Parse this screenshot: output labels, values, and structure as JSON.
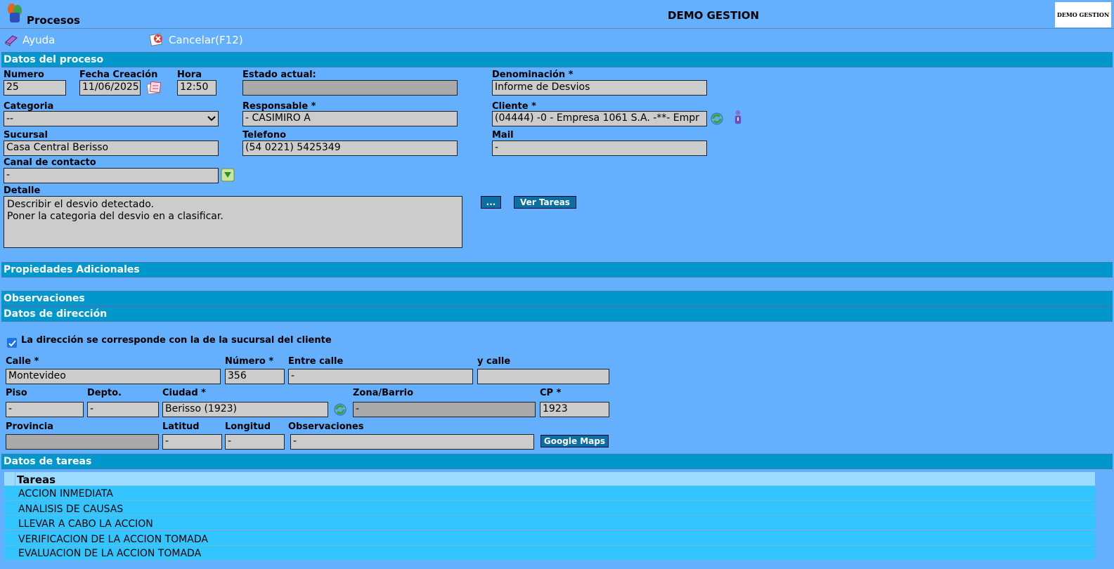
{
  "header": {
    "app_title": "Procesos",
    "center_title": "DEMO GESTION",
    "logo_text": "DEMO GESTION"
  },
  "toolbar": {
    "help_label": "Ayuda",
    "cancel_label": "Cancelar(F12)"
  },
  "sections": {
    "proceso": "Datos del proceso",
    "propiedades": "Propiedades Adicionales",
    "observaciones": "Observaciones",
    "direccion": "Datos de dirección",
    "tareas": "Datos de tareas"
  },
  "proceso": {
    "numero_label": "Numero",
    "numero": "25",
    "fecha_label": "Fecha Creación",
    "fecha": "11/06/2025",
    "hora_label": "Hora",
    "hora": "12:50",
    "estado_label": "Estado actual:",
    "estado": "",
    "denominacion_label": "Denominación *",
    "denominacion": "Informe de Desvios",
    "categoria_label": "Categoria",
    "categoria": "--",
    "responsable_label": "Responsable *",
    "responsable": "- CASIMIRO A",
    "cliente_label": "Cliente *",
    "cliente": "(04444) -0 - Empresa 1061 S.A. -**- Empr",
    "sucursal_label": "Sucursal",
    "sucursal": "Casa Central Berisso",
    "telefono_label": "Telefono",
    "telefono": "(54 0221) 5425349",
    "mail_label": "Mail",
    "mail": "-",
    "canal_label": "Canal de contacto",
    "canal": "-",
    "detalle_label": "Detalle",
    "detalle_line1": "Describir el desvio detectado.",
    "detalle_line2": "Poner la categoria del desvio en a clasificar.",
    "more_button": "...",
    "ver_tareas_button": "Ver Tareas"
  },
  "direccion": {
    "checkbox_label": "La dirección se corresponde con la de la sucursal del cliente",
    "checkbox_checked": true,
    "calle_label": "Calle *",
    "calle": "Montevideo",
    "numero_label": "Número *",
    "numero": "356",
    "entre_label": "Entre calle",
    "entre": "-",
    "ycalle_label": "y calle",
    "ycalle": "",
    "piso_label": "Piso",
    "piso": "-",
    "depto_label": "Depto.",
    "depto": "-",
    "ciudad_label": "Ciudad *",
    "ciudad": "Berisso (1923)",
    "zona_label": "Zona/Barrio",
    "zona": "-",
    "cp_label": "CP *",
    "cp": "1923",
    "provincia_label": "Provincia",
    "provincia": "",
    "latitud_label": "Latitud",
    "latitud": "-",
    "longitud_label": "Longitud",
    "longitud": "-",
    "obs_label": "Observaciones",
    "obs": "-",
    "maps_button": "Google Maps"
  },
  "tareas": {
    "column_header": "Tareas",
    "rows": [
      "ACCION INMEDIATA",
      "ANALISIS DE CAUSAS",
      "LLEVAR A CABO LA ACCION",
      "VERIFICACION DE LA ACCION TOMADA",
      "EVALUACION DE LA ACCION TOMADA"
    ]
  }
}
